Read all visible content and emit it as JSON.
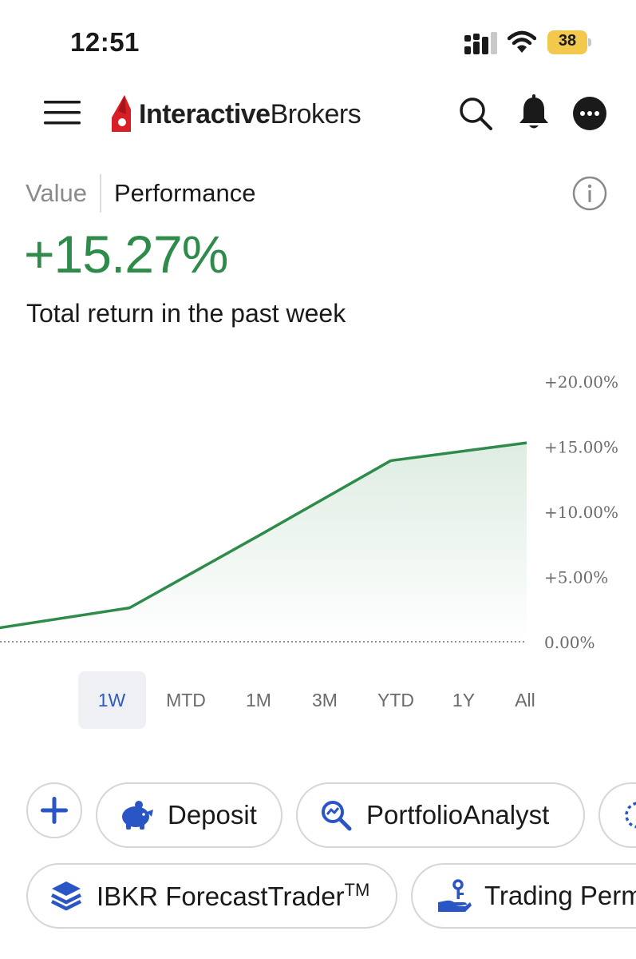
{
  "status_bar": {
    "time": "12:51",
    "battery": "38",
    "battery_color": "#f2c94c"
  },
  "header": {
    "logo_bold": "Interactive",
    "logo_regular": "Brokers",
    "icons": [
      "menu-icon",
      "search-icon",
      "bell-icon",
      "more-icon"
    ]
  },
  "toggle": {
    "value_label": "Value",
    "performance_label": "Performance",
    "selected": "Performance"
  },
  "summary": {
    "return_value": "+15.27%",
    "caption": "Total return in the past week"
  },
  "colors": {
    "accent_green": "#2e8b4a",
    "accent_blue": "#2f5bbf",
    "chip_icon_blue": "#2a55c4"
  },
  "chart_data": {
    "type": "area",
    "y_tick_labels": [
      "+20.00%",
      "+15.00%",
      "+10.00%",
      "+5.00%",
      "0.00%"
    ],
    "ylim": [
      0,
      20
    ],
    "x": [
      0,
      1,
      2,
      3,
      4
    ],
    "values": [
      1.0,
      2.6,
      8.2,
      13.9,
      15.27
    ],
    "baseline": 0,
    "grid": false,
    "legend": "none"
  },
  "range_tabs": {
    "items": [
      "1W",
      "MTD",
      "1M",
      "3M",
      "YTD",
      "1Y",
      "All"
    ],
    "selected": "1W"
  },
  "quick_actions": {
    "add_label": "+",
    "deposit": "Deposit",
    "portfolio_analyst": "PortfolioAnalyst",
    "forecast_trader": "IBKR ForecastTrader",
    "forecast_trader_tm": "TM",
    "trading_permissions": "Trading Perm"
  }
}
